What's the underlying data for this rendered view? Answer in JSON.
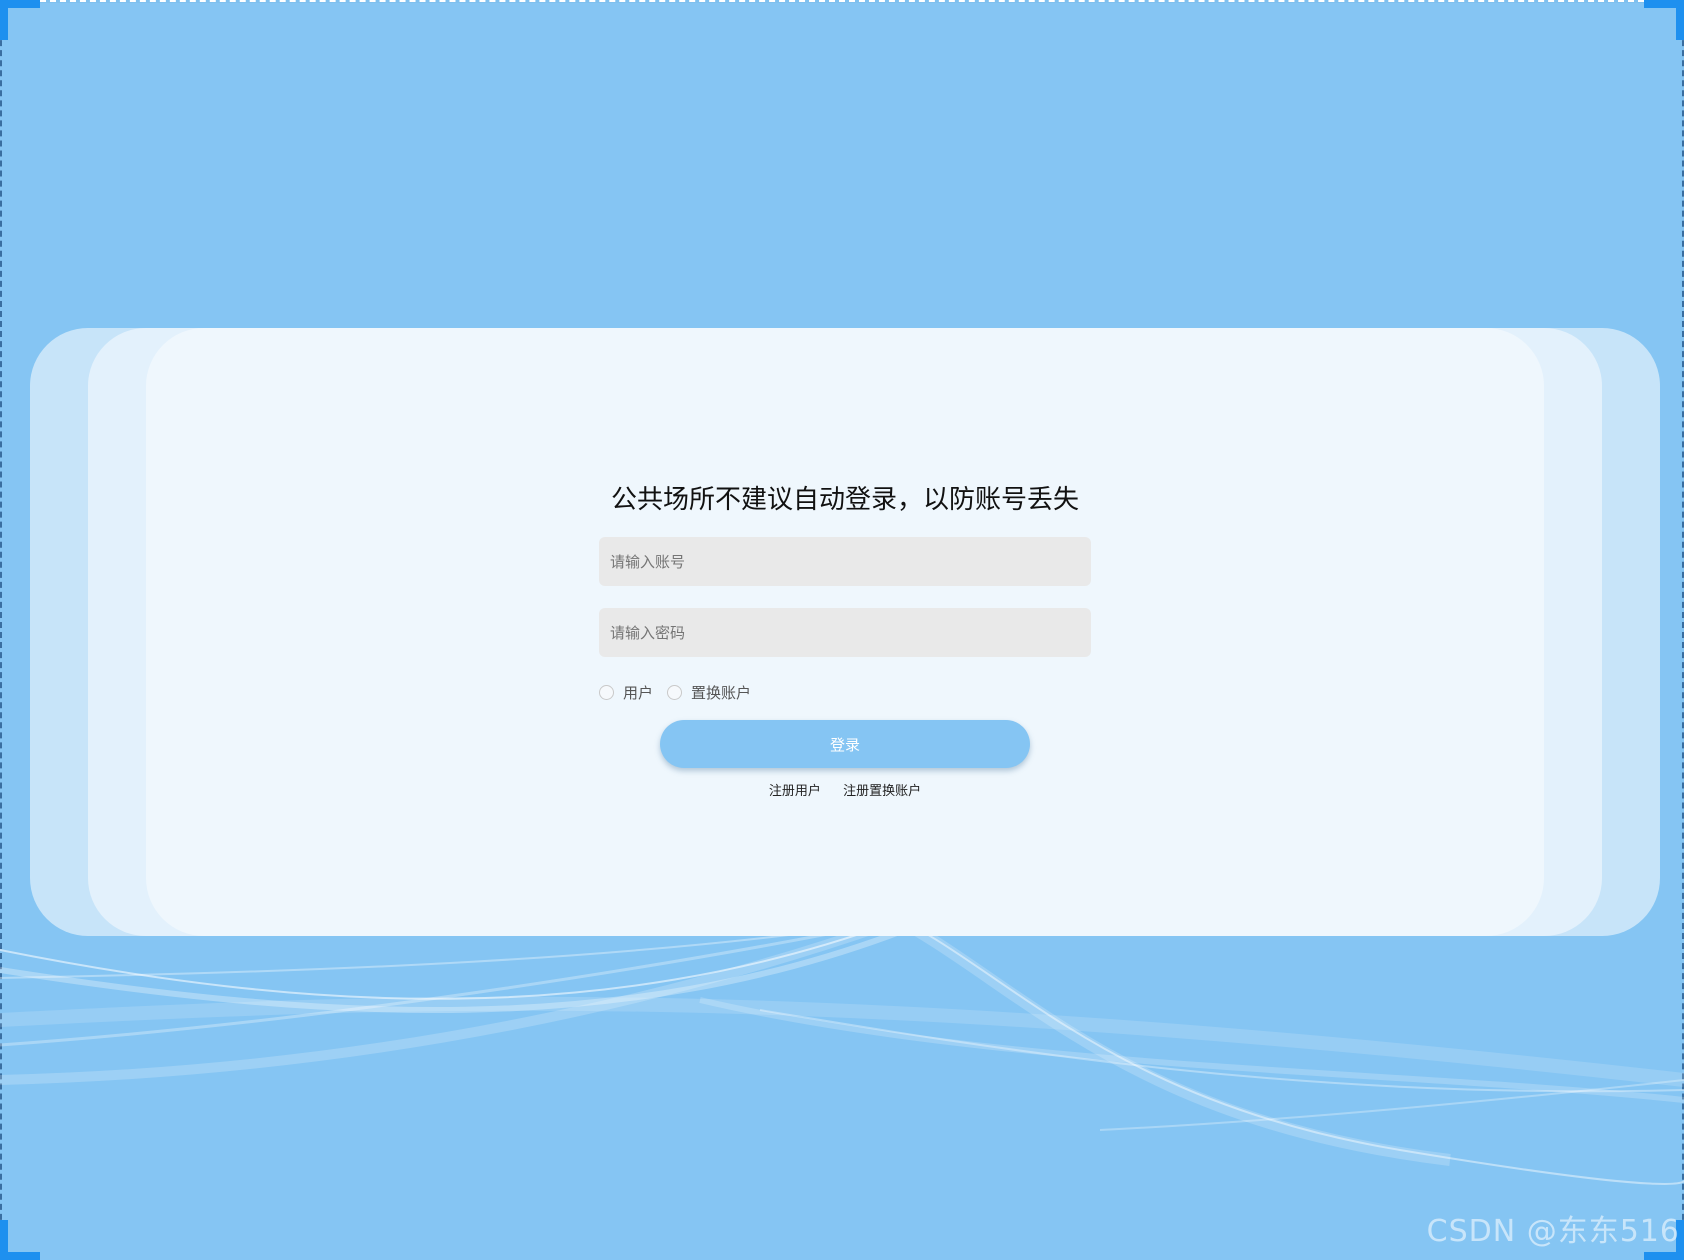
{
  "login": {
    "title": "公共场所不建议自动登录，以防账号丢失",
    "account_placeholder": "请输入账号",
    "password_placeholder": "请输入密码",
    "roles": [
      "用户",
      "置换账户"
    ],
    "login_button": "登录",
    "links": [
      "注册用户",
      "注册置换账户"
    ]
  },
  "watermark": "CSDN @东东516",
  "colors": {
    "background": "#85c5f3",
    "card": "#eff7fd",
    "input": "#e9e9e9",
    "button": "#85c5f3"
  }
}
